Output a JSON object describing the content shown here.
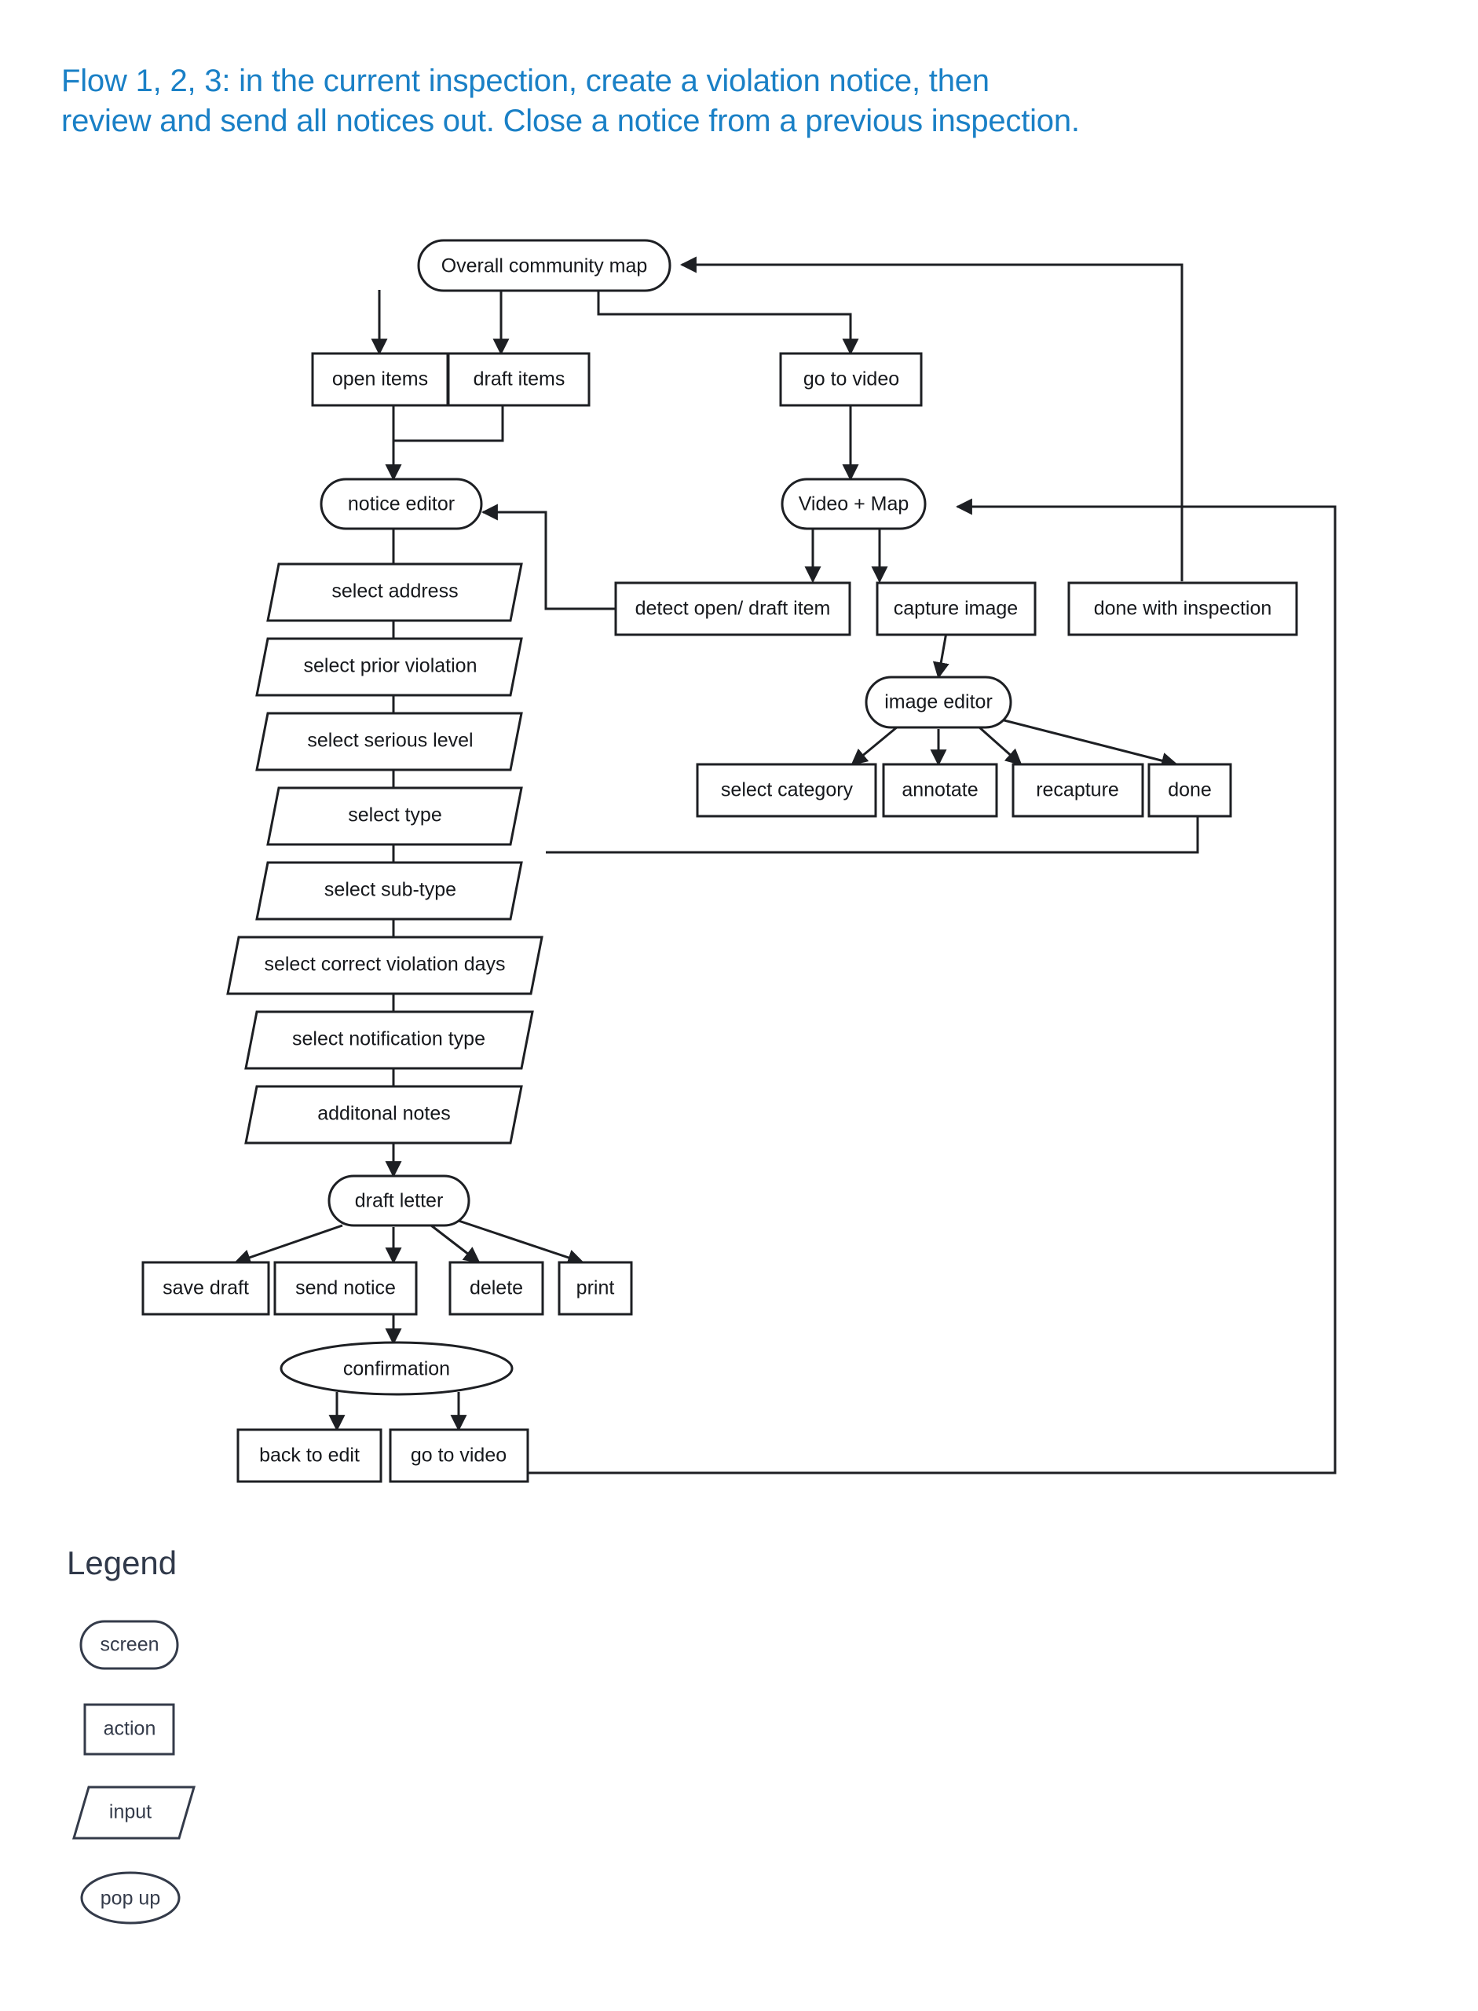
{
  "page": {
    "title_line_1": "Flow 1, 2, 3: in the current inspection, create a violation notice, then",
    "title_line_2": "review and send all notices out. Close a notice from a previous inspection.",
    "title_color": "#1a80c6",
    "background_color": "#ffffff",
    "stroke_color": "#1d1f23"
  },
  "legend": {
    "heading": "Legend",
    "heading_color": "#30394a",
    "items": [
      {
        "label": "screen",
        "shape": "stadium"
      },
      {
        "label": "action",
        "shape": "rectangle"
      },
      {
        "label": "input",
        "shape": "parallelogram"
      },
      {
        "label": "pop up",
        "shape": "ellipse"
      }
    ]
  },
  "chart_data": {
    "type": "flowchart",
    "title": "Flow 1, 2, 3: in the current inspection, create a violation notice, then review and send all notices out. Close a notice from a previous inspection.",
    "shape_legend": {
      "stadium": "screen",
      "rectangle": "action",
      "parallelogram": "input",
      "ellipse": "pop up"
    },
    "nodes": [
      {
        "id": "overall_community_map",
        "label": "Overall community map",
        "shape": "stadium"
      },
      {
        "id": "open_items",
        "label": "open items",
        "shape": "rectangle"
      },
      {
        "id": "draft_items",
        "label": "draft items",
        "shape": "rectangle"
      },
      {
        "id": "go_to_video_top",
        "label": "go to video",
        "shape": "rectangle"
      },
      {
        "id": "notice_editor",
        "label": "notice editor",
        "shape": "stadium"
      },
      {
        "id": "video_map",
        "label": "Video + Map",
        "shape": "stadium"
      },
      {
        "id": "select_address",
        "label": "select address",
        "shape": "parallelogram"
      },
      {
        "id": "detect_open_draft",
        "label": "detect open/ draft item",
        "shape": "rectangle"
      },
      {
        "id": "capture_image",
        "label": "capture image",
        "shape": "rectangle"
      },
      {
        "id": "done_with_inspection",
        "label": "done with inspection",
        "shape": "rectangle"
      },
      {
        "id": "select_prior_violation",
        "label": "select prior violation",
        "shape": "parallelogram"
      },
      {
        "id": "image_editor",
        "label": "image editor",
        "shape": "stadium"
      },
      {
        "id": "select_serious_level",
        "label": "select serious level",
        "shape": "parallelogram"
      },
      {
        "id": "select_category",
        "label": "select category",
        "shape": "rectangle"
      },
      {
        "id": "annotate",
        "label": "annotate",
        "shape": "rectangle"
      },
      {
        "id": "recapture",
        "label": "recapture",
        "shape": "rectangle"
      },
      {
        "id": "done",
        "label": "done",
        "shape": "rectangle"
      },
      {
        "id": "select_type",
        "label": "select type",
        "shape": "parallelogram"
      },
      {
        "id": "select_sub_type",
        "label": "select sub-type",
        "shape": "parallelogram"
      },
      {
        "id": "select_correct_days",
        "label": "select correct violation days",
        "shape": "parallelogram"
      },
      {
        "id": "select_notification",
        "label": "select notification type",
        "shape": "parallelogram"
      },
      {
        "id": "additonal_notes",
        "label": "additonal notes",
        "shape": "parallelogram"
      },
      {
        "id": "draft_letter",
        "label": "draft letter",
        "shape": "stadium"
      },
      {
        "id": "save_draft",
        "label": "save draft",
        "shape": "rectangle"
      },
      {
        "id": "send_notice",
        "label": "send notice",
        "shape": "rectangle"
      },
      {
        "id": "delete",
        "label": "delete",
        "shape": "rectangle"
      },
      {
        "id": "print",
        "label": "print",
        "shape": "rectangle"
      },
      {
        "id": "confirmation",
        "label": "confirmation",
        "shape": "ellipse"
      },
      {
        "id": "back_to_edit",
        "label": "back to edit",
        "shape": "rectangle"
      },
      {
        "id": "go_to_video_bottom",
        "label": "go to video",
        "shape": "rectangle"
      }
    ],
    "edges": [
      {
        "from": "overall_community_map",
        "to": "open_items"
      },
      {
        "from": "overall_community_map",
        "to": "draft_items"
      },
      {
        "from": "overall_community_map",
        "to": "go_to_video_top"
      },
      {
        "from": "open_items",
        "to": "notice_editor"
      },
      {
        "from": "draft_items",
        "to": "notice_editor"
      },
      {
        "from": "go_to_video_top",
        "to": "video_map"
      },
      {
        "from": "notice_editor",
        "to": "select_address"
      },
      {
        "from": "select_address",
        "to": "select_prior_violation"
      },
      {
        "from": "select_prior_violation",
        "to": "select_serious_level"
      },
      {
        "from": "select_serious_level",
        "to": "select_type"
      },
      {
        "from": "select_type",
        "to": "select_sub_type"
      },
      {
        "from": "select_sub_type",
        "to": "select_correct_days"
      },
      {
        "from": "select_correct_days",
        "to": "select_notification"
      },
      {
        "from": "select_notification",
        "to": "additonal_notes"
      },
      {
        "from": "additonal_notes",
        "to": "draft_letter"
      },
      {
        "from": "draft_letter",
        "to": "save_draft"
      },
      {
        "from": "draft_letter",
        "to": "send_notice"
      },
      {
        "from": "draft_letter",
        "to": "delete"
      },
      {
        "from": "draft_letter",
        "to": "print"
      },
      {
        "from": "send_notice",
        "to": "confirmation"
      },
      {
        "from": "confirmation",
        "to": "back_to_edit"
      },
      {
        "from": "confirmation",
        "to": "go_to_video_bottom"
      },
      {
        "from": "video_map",
        "to": "detect_open_draft"
      },
      {
        "from": "video_map",
        "to": "capture_image"
      },
      {
        "from": "capture_image",
        "to": "image_editor"
      },
      {
        "from": "image_editor",
        "to": "select_category"
      },
      {
        "from": "image_editor",
        "to": "annotate"
      },
      {
        "from": "image_editor",
        "to": "recapture"
      },
      {
        "from": "image_editor",
        "to": "done"
      },
      {
        "from": "detect_open_draft",
        "to": "notice_editor"
      },
      {
        "from": "done",
        "to": "notice_editor"
      },
      {
        "from": "done_with_inspection",
        "to": "overall_community_map"
      },
      {
        "from": "go_to_video_bottom",
        "to": "video_map"
      }
    ]
  }
}
